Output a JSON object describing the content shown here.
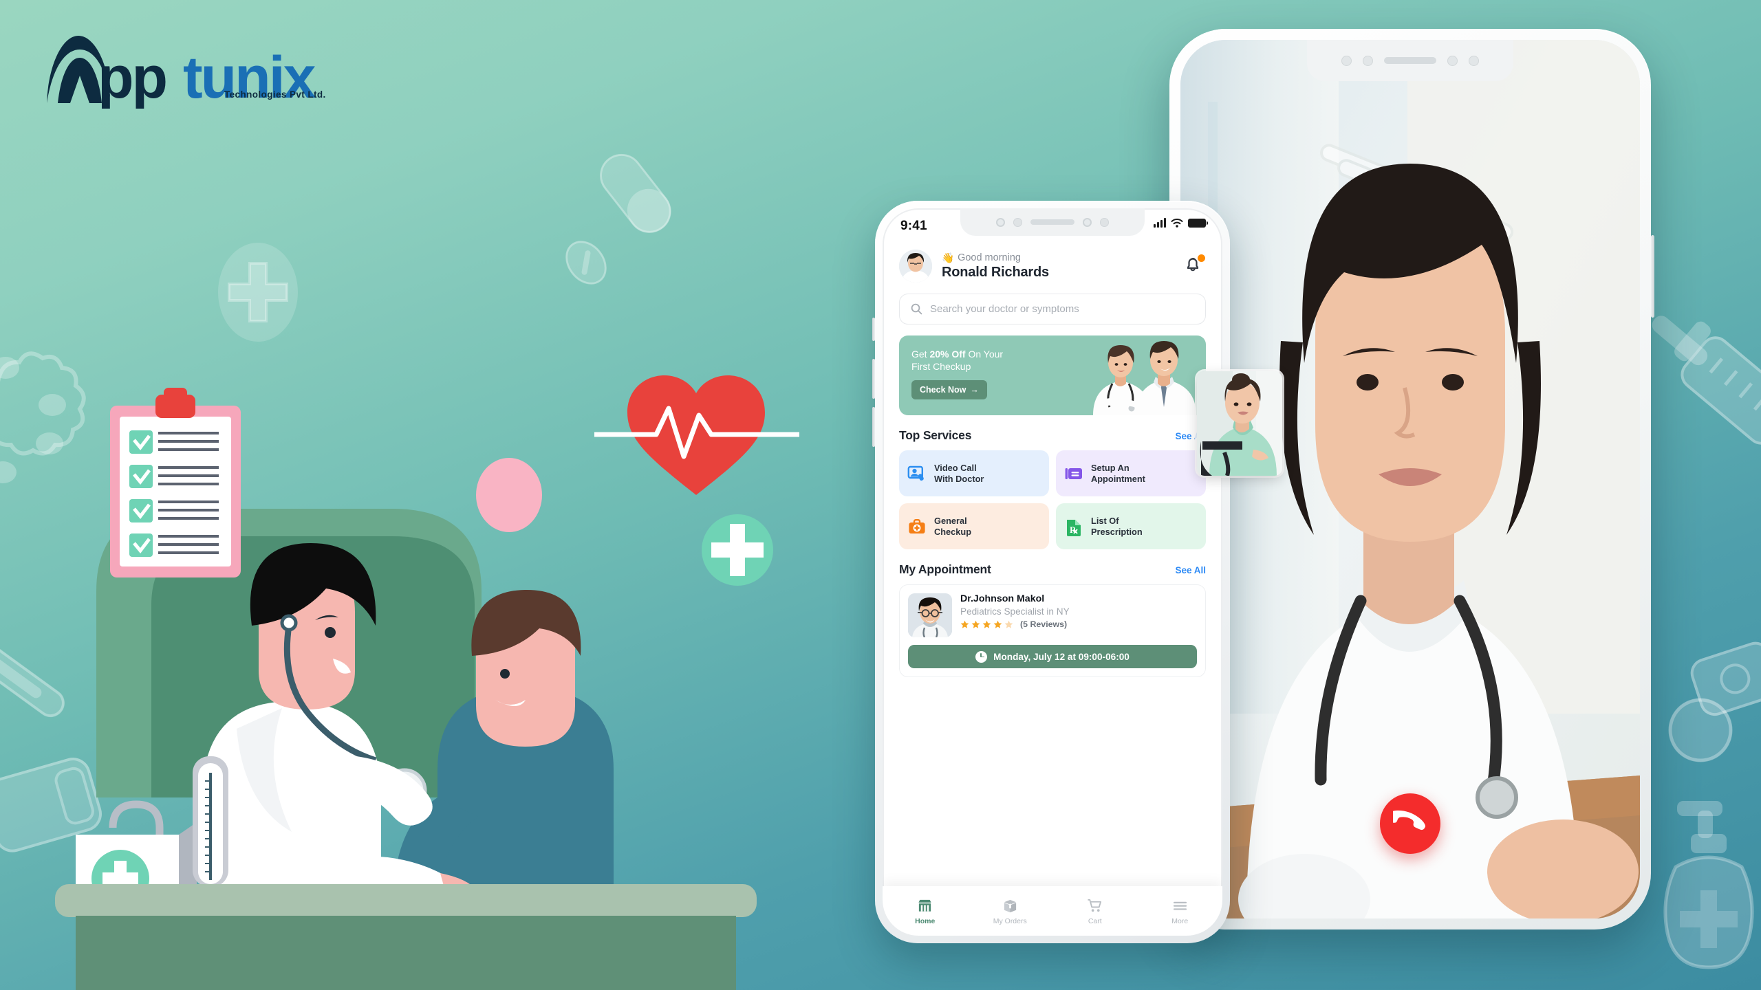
{
  "brand": {
    "name_part1": "App",
    "name_part2": "tunix",
    "tagline": "Technologies Pvt Ltd.",
    "color_dark": "#0d2b40",
    "color_blue": "#1a6fb5"
  },
  "background": {
    "gradient_top": "#9ad6c0",
    "gradient_bottom": "#3c8ca1",
    "decor_icons": [
      "pill-capsule-icon",
      "medical-cross-badge-icon",
      "heartbeat-icon",
      "syringe-icon",
      "virus-icon",
      "thermometer-icon",
      "bandage-icon",
      "sanitizer-bottle-icon",
      "cross-circle-icon"
    ]
  },
  "illustration": {
    "name": "doctor-examining-patient-illustration",
    "items": [
      "clipboard-checklist",
      "first-aid-kit",
      "thermometer-stand",
      "armchair",
      "desk"
    ]
  },
  "phone_app": {
    "status_bar": {
      "time": "9:41",
      "signal_icon": "signal-bars-icon",
      "wifi_icon": "wifi-icon",
      "battery_icon": "battery-full-icon"
    },
    "header": {
      "avatar": "user-avatar",
      "greeting_emoji": "👋",
      "greeting": "Good morning",
      "user_name": "Ronald Richards",
      "bell_icon": "notification-bell-icon",
      "has_notification": true
    },
    "search": {
      "placeholder": "Search your doctor or symptoms",
      "icon": "search-icon"
    },
    "promo": {
      "line_pre": "Get ",
      "line_bold": "20% Off",
      "line_post": " On Your",
      "line2": "First Checkup",
      "button": "Check Now",
      "button_arrow": "→",
      "bg_color": "#8fc9b6",
      "button_color": "#5d8f77"
    },
    "top_services": {
      "title": "Top Services",
      "see_all": "See All",
      "cards": [
        {
          "label1": "Video Call",
          "label2": "With Doctor",
          "icon": "video-call-icon",
          "bg": "#e4effd",
          "accent": "#2b8ef0"
        },
        {
          "label1": "Setup An",
          "label2": "Appointment",
          "icon": "appointment-card-icon",
          "bg": "#f0eafd",
          "accent": "#8456e8"
        },
        {
          "label1": "General",
          "label2": "Checkup",
          "icon": "first-aid-kit-icon",
          "bg": "#fdece0",
          "accent": "#f57e14"
        },
        {
          "label1": "List Of",
          "label2": "Prescription",
          "icon": "prescription-rx-icon",
          "bg": "#e2f6ea",
          "accent": "#2bb563"
        }
      ]
    },
    "my_appointment": {
      "title": "My Appointment",
      "see_all": "See All",
      "doctor_name": "Dr.Johnson Makol",
      "doctor_specialty": "Pediatrics Specialist in NY",
      "rating": 4,
      "rating_max": 5,
      "reviews": "(5 Reviews)",
      "schedule": "Monday, July 12 at 09:00-06:00",
      "clock_icon": "clock-icon",
      "doctor_photo": "doctor-portrait"
    },
    "tabbar": [
      {
        "label": "Home",
        "icon": "storefront-icon",
        "active": true
      },
      {
        "label": "My Orders",
        "icon": "package-box-icon",
        "active": false
      },
      {
        "label": "Cart",
        "icon": "shopping-cart-icon",
        "active": false
      },
      {
        "label": "More",
        "icon": "hamburger-menu-icon",
        "active": false
      }
    ]
  },
  "phone_video_call": {
    "main_view": "doctor-video-feed",
    "pip_view": "patient-in-wheelchair-video-feed",
    "end_call_button": {
      "icon": "end-call-icon",
      "color": "#f42c2c"
    }
  }
}
